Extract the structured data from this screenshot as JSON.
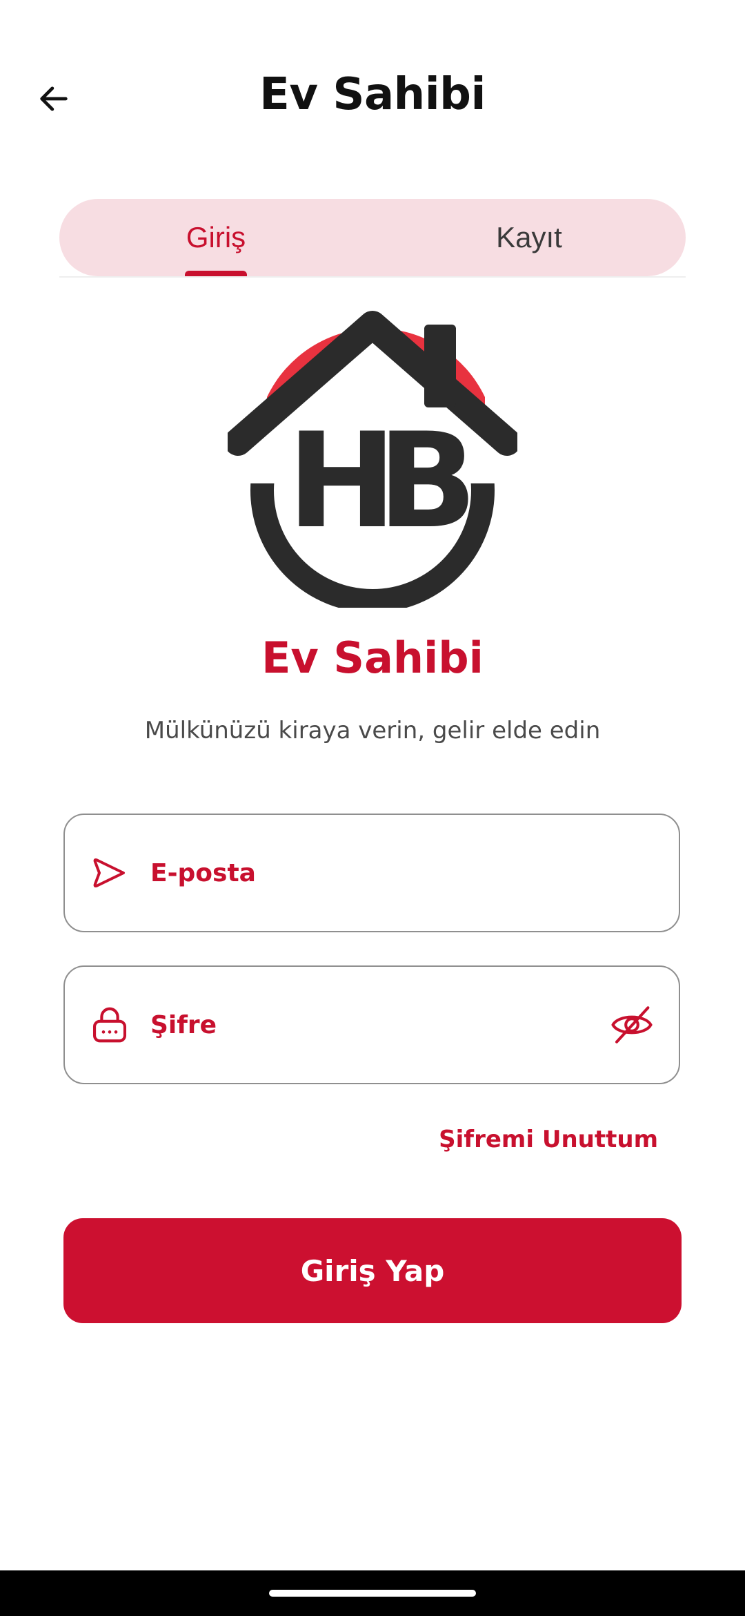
{
  "header": {
    "title": "Ev Sahibi",
    "back_icon": "arrow-left-icon"
  },
  "tabs": [
    {
      "label": "Giriş",
      "active": true
    },
    {
      "label": "Kayıt",
      "active": false
    }
  ],
  "brand": {
    "logo_icon": "house-hb-logo",
    "logo_text": "HB",
    "app_name": "Ev Sahibi",
    "tagline": "Mülkünüzü kiraya verin, gelir elde edin"
  },
  "form": {
    "email": {
      "placeholder": "E-posta",
      "value": "",
      "icon": "send-icon"
    },
    "password": {
      "placeholder": "Şifre",
      "value": "",
      "icon": "lock-icon",
      "toggle_icon": "eye-off-icon"
    },
    "forgot_label": "Şifremi Unuttum",
    "submit_label": "Giriş Yap"
  },
  "colors": {
    "accent": "#c8102e",
    "tab_background": "#f7dde2",
    "logo_red": "#e8323f",
    "logo_dark": "#2b2b2b",
    "text_dark": "#111111",
    "text_muted": "#4a4a4a"
  }
}
